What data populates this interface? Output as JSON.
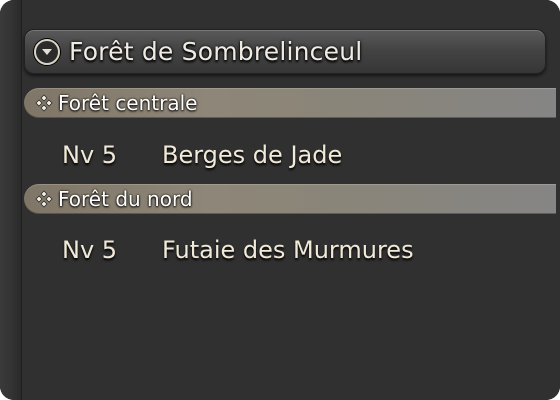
{
  "region": {
    "title": "Forêt de Sombrelinceul",
    "collapse_icon": "collapse-arrow-icon"
  },
  "areas": [
    {
      "title": "Forêt centrale",
      "icon": "four-diamond-icon",
      "entries": [
        {
          "level": "Nv 5",
          "name": "Berges de Jade"
        }
      ]
    },
    {
      "title": "Forêt du nord",
      "icon": "four-diamond-icon",
      "entries": [
        {
          "level": "Nv 5",
          "name": "Futaie des Murmures"
        }
      ]
    }
  ],
  "colors": {
    "panel_bg": "#303030",
    "header_text": "#f0ece4",
    "entry_text": "#f1ead8",
    "area_bar": "#8e8678"
  }
}
